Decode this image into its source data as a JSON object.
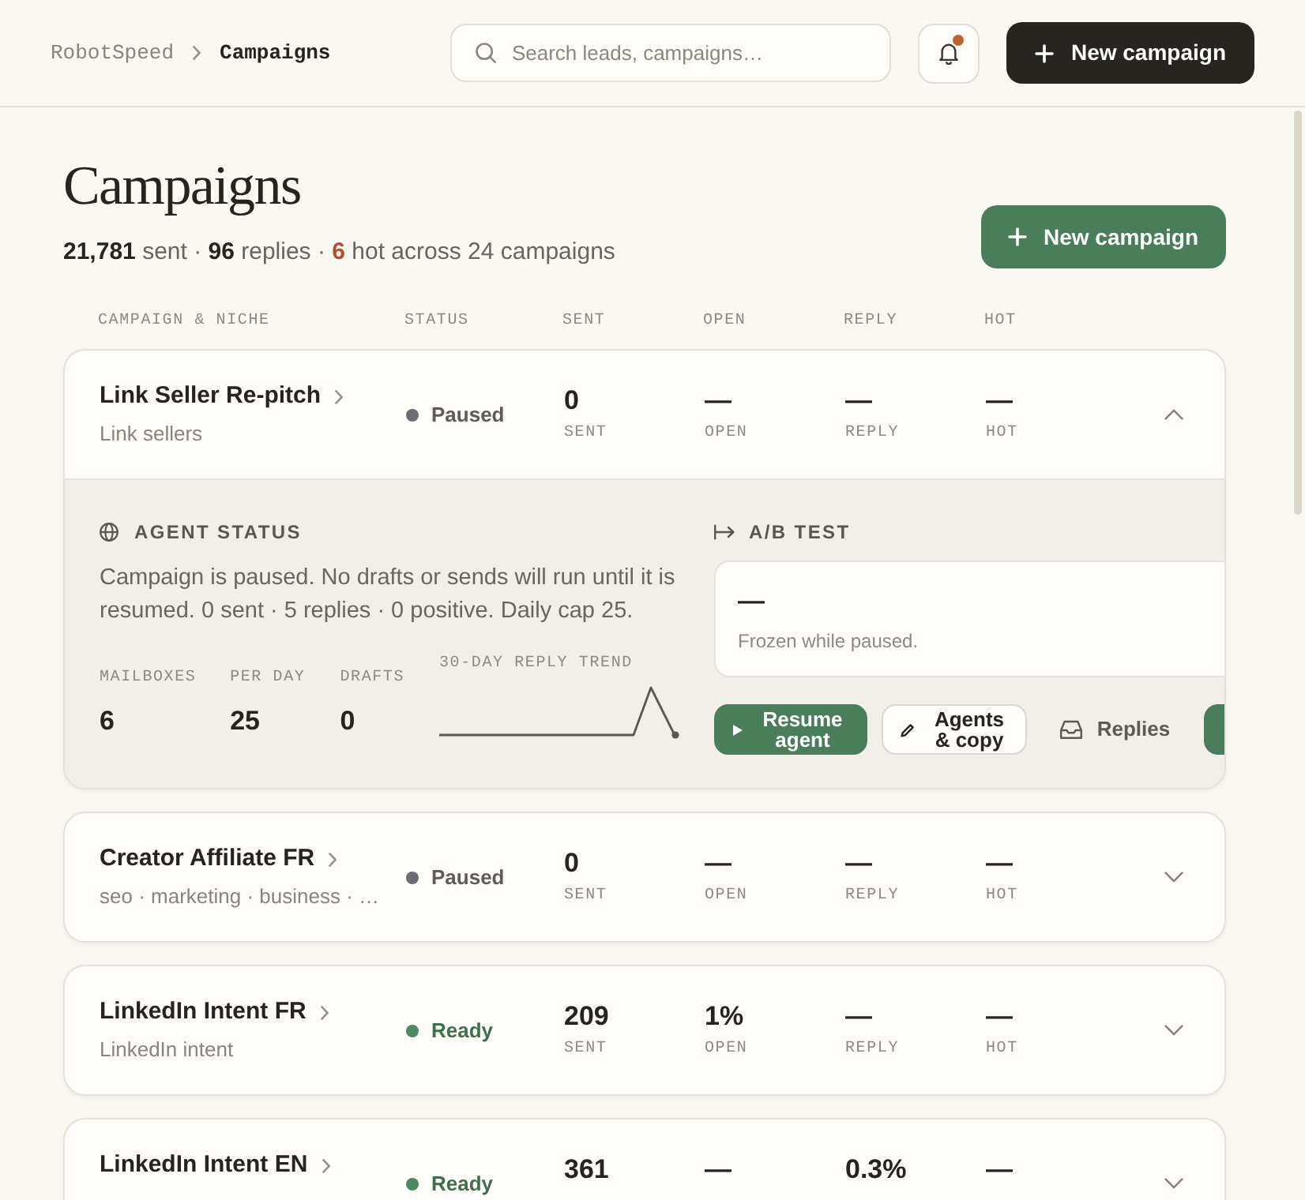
{
  "header": {
    "breadcrumb": [
      {
        "label": "RobotSpeed",
        "current": false
      },
      {
        "label": "Campaigns",
        "current": true
      }
    ],
    "search": {
      "placeholder": "Search leads, campaigns…"
    },
    "notifications": {
      "unread": true
    },
    "new_campaign": "New campaign"
  },
  "page": {
    "title": "Campaigns",
    "summary": [
      {
        "kind": "number",
        "text": "21,781"
      },
      {
        "kind": "label",
        "text": "sent ·"
      },
      {
        "kind": "number",
        "text": "96"
      },
      {
        "kind": "label",
        "text": "replies ·"
      },
      {
        "kind": "hot",
        "text": "6"
      },
      {
        "kind": "label",
        "text": "hot across 24 campaigns"
      }
    ],
    "new_campaign": "New campaign"
  },
  "columns": [
    "CAMPAIGN & NICHE",
    "STATUS",
    "SENT",
    "OPEN",
    "REPLY",
    "HOT"
  ],
  "campaigns": [
    {
      "name": "Link Seller Re-pitch",
      "niche": "Link sellers",
      "status": {
        "label": "Paused",
        "kind": "paused",
        "color": "#6c6d72"
      },
      "stats": [
        {
          "value": "0",
          "label": "SENT"
        },
        {
          "value": "—",
          "label": "OPEN"
        },
        {
          "value": "—",
          "label": "REPLY"
        },
        {
          "value": "—",
          "label": "HOT"
        }
      ],
      "expanded": true,
      "detail": {
        "agent_status": {
          "title": "AGENT STATUS",
          "text": "Campaign is paused. No drafts or sends will run until it is resumed. 0 sent · 5 replies · 0 positive. Daily cap 25.",
          "stats": [
            {
              "label": "MAILBOXES",
              "value": "6"
            },
            {
              "label": "PER DAY",
              "value": "25"
            },
            {
              "label": "DRAFTS",
              "value": "0"
            }
          ],
          "trend_label": "30-DAY REPLY TREND"
        },
        "ab_test": {
          "title": "A/B TEST",
          "value": "—",
          "note": "Frozen while paused."
        },
        "actions": [
          {
            "kind": "resume",
            "label": "Resume agent"
          },
          {
            "kind": "edit",
            "label": "Agents & copy"
          },
          {
            "kind": "inbox",
            "label": "Replies"
          },
          {
            "kind": "primary"
          }
        ]
      }
    },
    {
      "name": "Creator Affiliate FR",
      "niche": "seo · marketing · business · …",
      "status": {
        "label": "Paused",
        "kind": "paused",
        "color": "#6c6d72"
      },
      "stats": [
        {
          "value": "0",
          "label": "SENT"
        },
        {
          "value": "—",
          "label": "OPEN"
        },
        {
          "value": "—",
          "label": "REPLY"
        },
        {
          "value": "—",
          "label": "HOT"
        }
      ],
      "expanded": false
    },
    {
      "name": "LinkedIn Intent FR",
      "niche": "LinkedIn intent",
      "status": {
        "label": "Ready",
        "kind": "ready",
        "color": "#4e8a60"
      },
      "stats": [
        {
          "value": "209",
          "label": "SENT"
        },
        {
          "value": "1%",
          "label": "OPEN"
        },
        {
          "value": "—",
          "label": "REPLY"
        },
        {
          "value": "—",
          "label": "HOT"
        }
      ],
      "expanded": false
    },
    {
      "name": "LinkedIn Intent EN",
      "status": {
        "label": "Ready",
        "kind": "ready",
        "color": "#4e8a60"
      },
      "stats": [
        {
          "value": "361"
        },
        {
          "value": "—"
        },
        {
          "value": "0.3%"
        },
        {
          "value": "—"
        }
      ],
      "expanded": false
    }
  ]
}
